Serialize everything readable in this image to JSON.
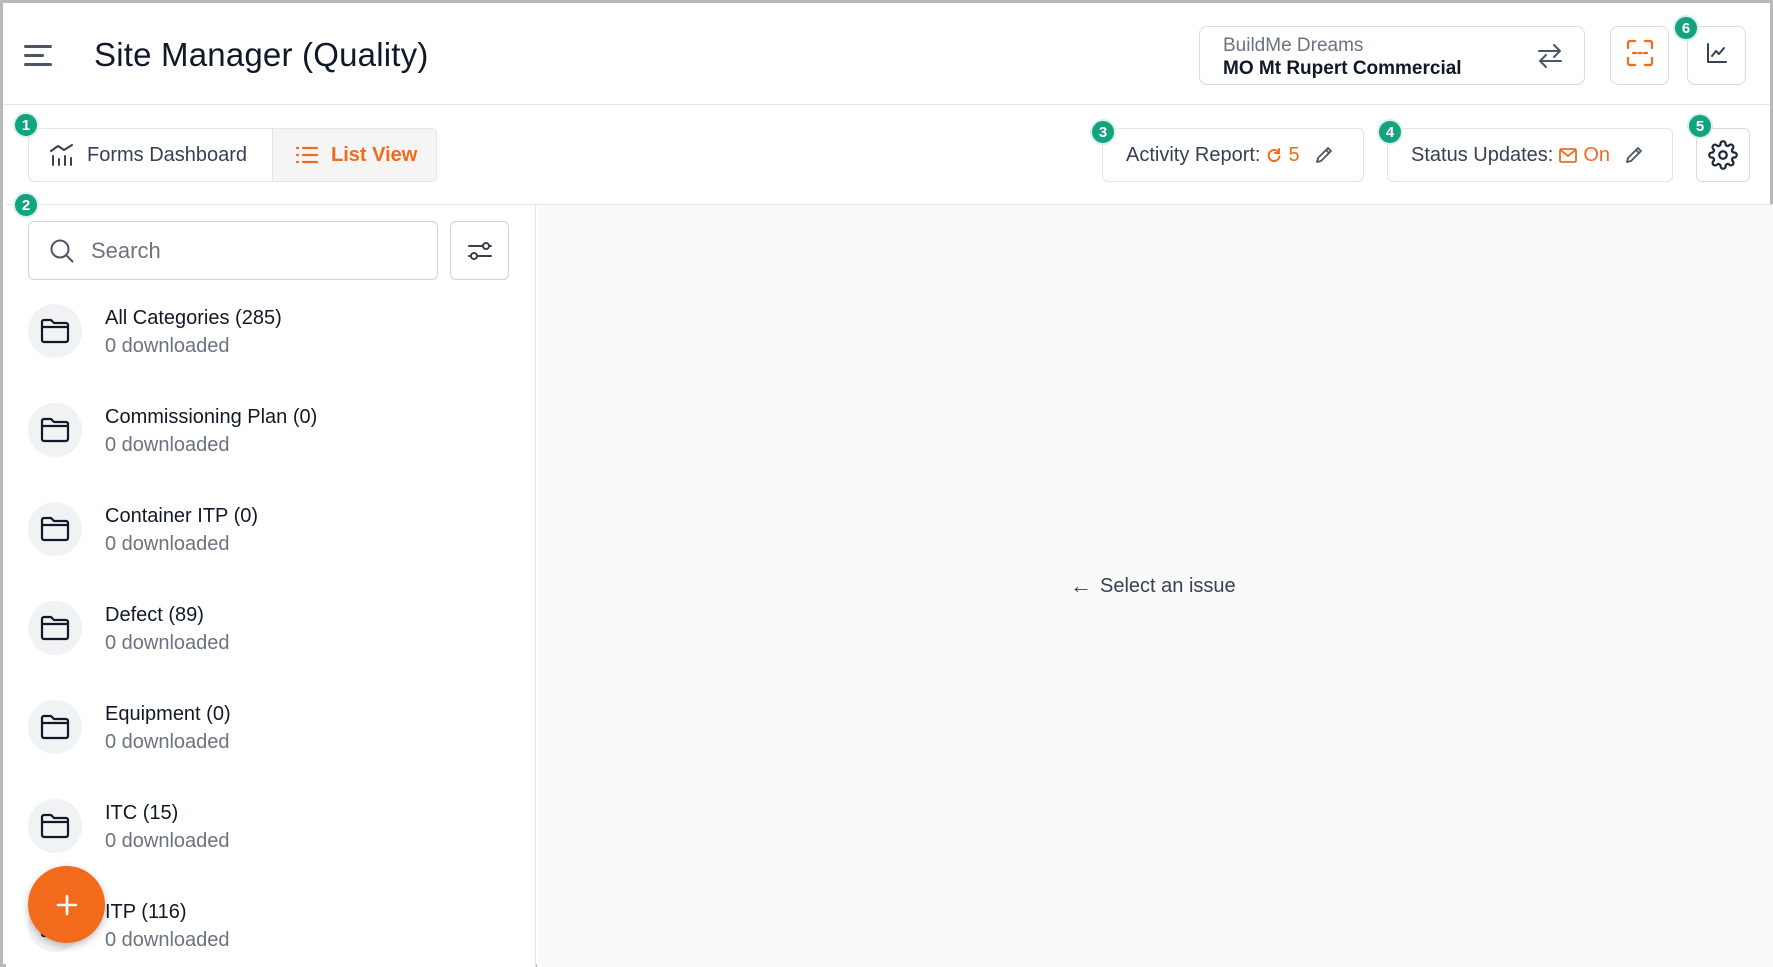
{
  "header": {
    "title": "Site Manager (Quality)",
    "menu_icon": "hamburger-menu-icon"
  },
  "project": {
    "company": "BuildMe Dreams",
    "name": "MO Mt Rupert Commercial",
    "switch_icon": "swap-arrows-icon"
  },
  "header_buttons": {
    "scan_icon": "scan-frame-icon",
    "chart_icon": "trend-chart-icon",
    "accent": "#f26b1d"
  },
  "view_toggle": {
    "dashboard_label": "Forms Dashboard",
    "list_label": "List View",
    "active": "List View"
  },
  "activity_report": {
    "label": "Activity Report:",
    "value": "5"
  },
  "status_updates": {
    "label": "Status Updates:",
    "value": "On"
  },
  "search": {
    "placeholder": "Search",
    "value": ""
  },
  "categories": [
    {
      "title": "All Categories (285)",
      "sub": "0 downloaded"
    },
    {
      "title": "Commissioning Plan (0)",
      "sub": "0 downloaded"
    },
    {
      "title": "Container ITP (0)",
      "sub": "0 downloaded"
    },
    {
      "title": "Defect (89)",
      "sub": "0 downloaded"
    },
    {
      "title": "Equipment (0)",
      "sub": "0 downloaded"
    },
    {
      "title": "ITC (15)",
      "sub": "0 downloaded"
    },
    {
      "title": "ITP (116)",
      "sub": "0 downloaded"
    }
  ],
  "detail": {
    "empty_text": "Select an issue",
    "arrow": "←"
  },
  "callouts": [
    "1",
    "2",
    "3",
    "4",
    "5",
    "6"
  ],
  "colors": {
    "accent": "#f26b1d",
    "badge": "#14a37f"
  }
}
